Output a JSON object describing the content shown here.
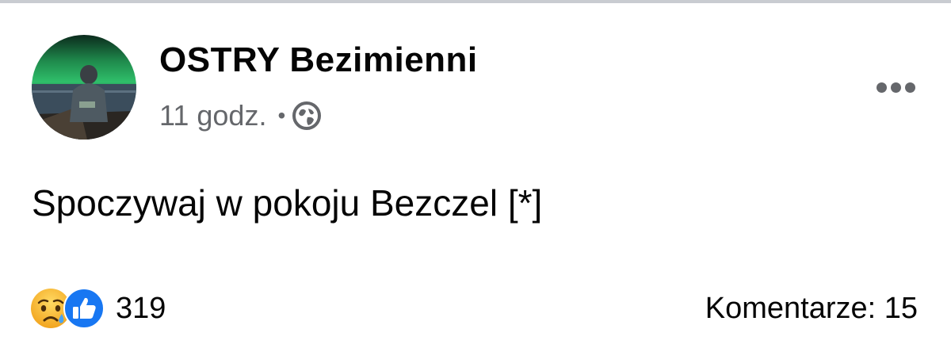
{
  "post": {
    "author": "OSTRY Bezimienni",
    "time": "11 godz.",
    "separator": "•",
    "privacy_icon": "globe-icon",
    "more_icon": "more-options-icon",
    "text": "Spoczywaj w pokoju Bezczel [*]",
    "reactions": {
      "icons": [
        "sad-reaction-icon",
        "like-reaction-icon"
      ],
      "count": "319"
    },
    "comments": "Komentarze: 15"
  },
  "colors": {
    "text_primary": "#050505",
    "text_secondary": "#65676b",
    "like_blue": "#1877f2",
    "sad_yellow": "#f7b125",
    "divider": "#c9ccd1"
  }
}
